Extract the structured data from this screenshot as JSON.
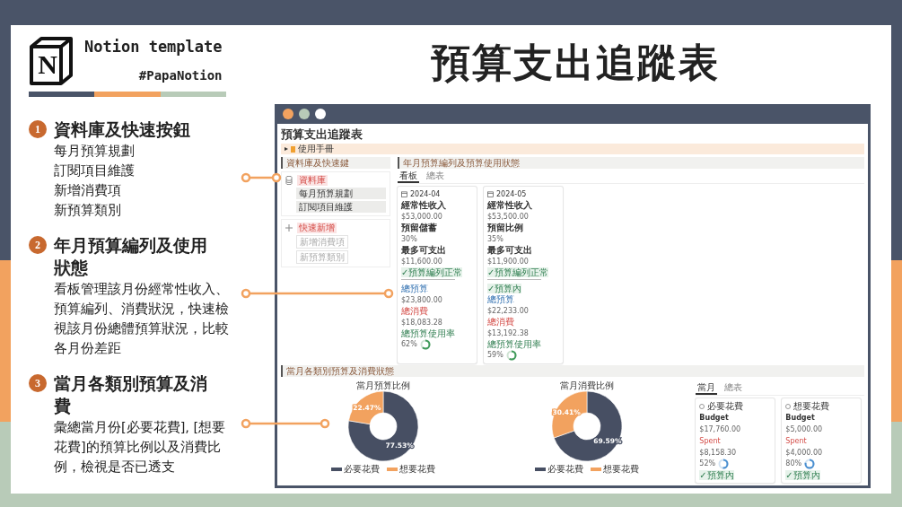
{
  "slide": {
    "logo_letter": "N",
    "brand": "Notion template",
    "hashtag": "#PapaNotion",
    "title": "預算支出追蹤表"
  },
  "features": [
    {
      "number": "1",
      "heading": "資料庫及快速按鈕",
      "lines": [
        "每月預算規劃",
        "訂閱項目維護",
        "新增消費項",
        "新預算類別"
      ]
    },
    {
      "number": "2",
      "heading": "年月預算編列及使用狀態",
      "description": "看板管理該月份經常性收入、預算編列、消費狀況，快速檢視該月份總體預算狀況，比較各月份差距"
    },
    {
      "number": "3",
      "heading": "當月各類別預算及消費",
      "description": "彙總當月份[必要花費], [想要花費]的預算比例以及消費比例，檢視是否已透支"
    }
  ],
  "page": {
    "title": "預算支出追蹤表",
    "toggle": "使用手冊",
    "quick": {
      "header": "資料庫及快速鍵",
      "groups": [
        {
          "kind": "database",
          "tag": "資料庫",
          "items": [
            "每月預算規劃",
            "訂閱項目維護"
          ]
        },
        {
          "kind": "buttons",
          "tag": "快速新增",
          "items": [
            "新增消費項",
            "新預算類別"
          ]
        }
      ]
    },
    "monthly": {
      "header": "年月預算編列及預算使用狀態",
      "tabs": [
        {
          "label": "看板",
          "selected": true
        },
        {
          "label": "總表",
          "selected": false
        }
      ],
      "cards": [
        {
          "title": "2024-04",
          "fields": [
            {
              "kind": "label",
              "text": "經常性收入"
            },
            {
              "kind": "value",
              "text": "$53,000.00"
            },
            {
              "kind": "label",
              "text": "預留儲蓄"
            },
            {
              "kind": "value",
              "text": "30%"
            },
            {
              "kind": "label",
              "text": "最多可支出"
            },
            {
              "kind": "value",
              "text": "$11,600.00"
            },
            {
              "kind": "good",
              "text": "✓預算編列正常"
            },
            {
              "kind": "divider"
            },
            {
              "kind": "budget",
              "text": "總預算"
            },
            {
              "kind": "value",
              "text": "$23,800.00"
            },
            {
              "kind": "spent",
              "text": "總消費"
            },
            {
              "kind": "value",
              "text": "$18,083.28"
            },
            {
              "kind": "rate",
              "text": "總預算使用率"
            },
            {
              "kind": "ring",
              "text": "62%"
            }
          ]
        },
        {
          "title": "2024-05",
          "fields": [
            {
              "kind": "label",
              "text": "經常性收入"
            },
            {
              "kind": "value",
              "text": "$53,500.00"
            },
            {
              "kind": "label",
              "text": "預留比例"
            },
            {
              "kind": "value",
              "text": "35%"
            },
            {
              "kind": "label",
              "text": "最多可支出"
            },
            {
              "kind": "value",
              "text": "$11,900.00"
            },
            {
              "kind": "good",
              "text": "✓預算編列正常"
            },
            {
              "kind": "divider"
            },
            {
              "kind": "good",
              "text": "✓預算內"
            },
            {
              "kind": "budget",
              "text": "總預算"
            },
            {
              "kind": "value",
              "text": "$22,233.00"
            },
            {
              "kind": "spent",
              "text": "總消費"
            },
            {
              "kind": "value",
              "text": "$13,192.38"
            },
            {
              "kind": "rate",
              "text": "總預算使用率"
            },
            {
              "kind": "ring",
              "text": "59%"
            }
          ]
        }
      ]
    },
    "category": {
      "header": "當月各類別預算及消費狀態",
      "charts": [
        {
          "chart_data": {
            "type": "donut",
            "title": "當月預算比例",
            "categories": [
              "必要花費",
              "想要花費"
            ],
            "values": [
              77.53,
              22.47
            ],
            "data_labels": true,
            "value_labels": [
              "77.53%",
              "22.47%"
            ],
            "legend": "bottom"
          }
        },
        {
          "chart_data": {
            "type": "donut",
            "title": "當月消費比例",
            "categories": [
              "必要花費",
              "想要花費"
            ],
            "values": [
              69.59,
              30.41
            ],
            "data_labels": true,
            "value_labels": [
              "69.59%",
              "30.41%"
            ],
            "legend": "bottom"
          }
        }
      ],
      "tabs": [
        {
          "label": "當月",
          "selected": true
        },
        {
          "label": "總表",
          "selected": false
        }
      ],
      "cards": [
        {
          "title": "必要花費",
          "budget_label": "Budget",
          "budget": "$17,760.00",
          "spent_label": "Spent",
          "spent": "$8,158.30",
          "usage": "52%",
          "status": "✓預算內"
        },
        {
          "title": "想要花費",
          "budget_label": "Budget",
          "budget": "$5,000.00",
          "spent_label": "Spent",
          "spent": "$4,000.00",
          "usage": "80%",
          "status": "✓預算內"
        }
      ]
    }
  }
}
